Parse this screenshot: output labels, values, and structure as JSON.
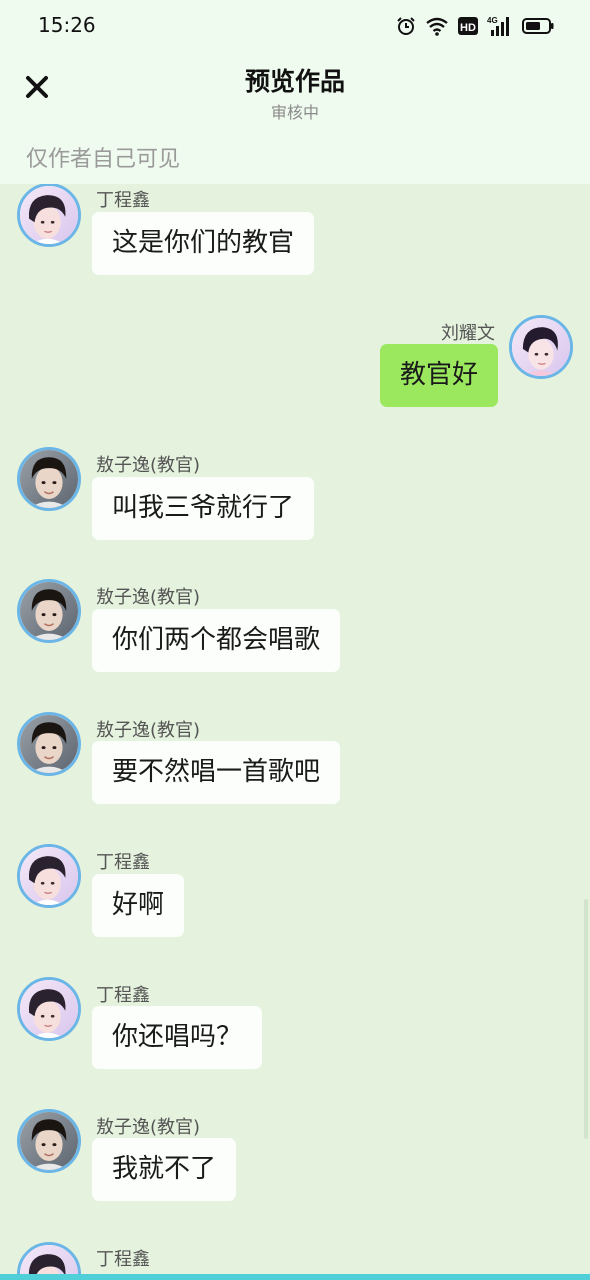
{
  "status_bar": {
    "time": "15:26",
    "icons": [
      "alarm-icon",
      "wifi-icon",
      "hd-icon",
      "4g-signal-icon",
      "battery-icon"
    ],
    "hd_label": "HD",
    "network_label": "4G"
  },
  "header": {
    "close_icon": "close-icon",
    "title": "预览作品",
    "subtitle": "审核中",
    "visibility_note": "仅作者自己可见"
  },
  "colors": {
    "background": "#e5f3de",
    "header_background": "#f0fbf0",
    "left_bubble": "#fbfefa",
    "right_bubble": "#9be85f",
    "avatar_border": "#6bb6e6"
  },
  "messages": [
    {
      "side": "left",
      "name": "丁程鑫",
      "text": "这是你们的教官",
      "avatar": "ding-avatar"
    },
    {
      "side": "right",
      "name": "刘耀文",
      "text": "教官好",
      "avatar": "liu-avatar"
    },
    {
      "side": "left",
      "name": "敖子逸(教官)",
      "text": "叫我三爷就行了",
      "avatar": "ao-avatar"
    },
    {
      "side": "left",
      "name": "敖子逸(教官)",
      "text": "你们两个都会唱歌",
      "avatar": "ao-avatar"
    },
    {
      "side": "left",
      "name": "敖子逸(教官)",
      "text": "要不然唱一首歌吧",
      "avatar": "ao-avatar"
    },
    {
      "side": "left",
      "name": "丁程鑫",
      "text": "好啊",
      "avatar": "ding-avatar"
    },
    {
      "side": "left",
      "name": "丁程鑫",
      "text": "你还唱吗？",
      "avatar": "ding-avatar"
    },
    {
      "side": "left",
      "name": "敖子逸(教官)",
      "text": "我就不了",
      "avatar": "ao-avatar"
    },
    {
      "side": "left",
      "name": "丁程鑫",
      "text": "",
      "avatar": "ding-avatar"
    }
  ]
}
